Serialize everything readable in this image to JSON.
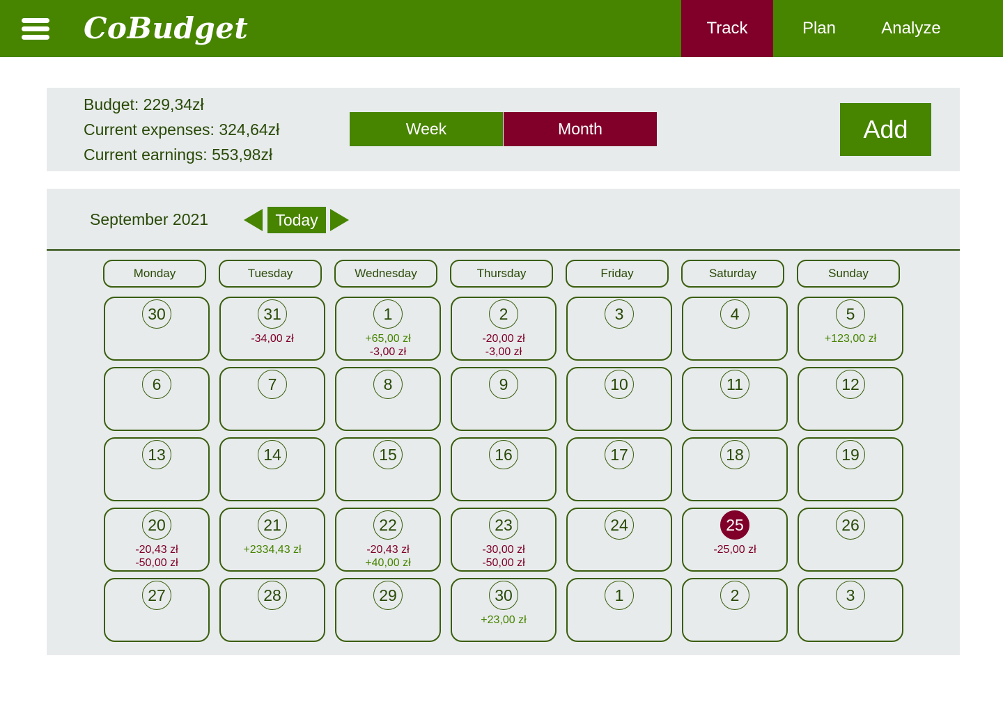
{
  "app": {
    "brand": "CoBudget",
    "nav": [
      {
        "label": "Track",
        "active": true
      },
      {
        "label": "Plan",
        "active": false
      },
      {
        "label": "Analyze",
        "active": false
      }
    ]
  },
  "summary": {
    "budget": "Budget: 229,34zł",
    "expenses": "Current expenses: 324,64zł",
    "earnings": "Current earnings: 553,98zł",
    "view_toggle": [
      {
        "label": "Week",
        "active": false
      },
      {
        "label": "Month",
        "active": true
      }
    ],
    "add_label": "Add"
  },
  "calendar": {
    "month_label": "September 2021",
    "today_label": "Today",
    "weekdays": [
      "Monday",
      "Tuesday",
      "Wednesday",
      "Thursday",
      "Friday",
      "Saturday",
      "Sunday"
    ],
    "weeks": [
      [
        {
          "day": "30",
          "tx": []
        },
        {
          "day": "31",
          "tx": [
            {
              "text": "-34,00 zł",
              "kind": "neg"
            }
          ]
        },
        {
          "day": "1",
          "tx": [
            {
              "text": "+65,00 zł",
              "kind": "pos"
            },
            {
              "text": "-3,00 zł",
              "kind": "neg"
            }
          ]
        },
        {
          "day": "2",
          "tx": [
            {
              "text": "-20,00 zł",
              "kind": "neg"
            },
            {
              "text": "-3,00 zł",
              "kind": "neg"
            }
          ]
        },
        {
          "day": "3",
          "tx": []
        },
        {
          "day": "4",
          "tx": []
        },
        {
          "day": "5",
          "tx": [
            {
              "text": "+123,00 zł",
              "kind": "pos"
            }
          ]
        }
      ],
      [
        {
          "day": "6",
          "tx": []
        },
        {
          "day": "7",
          "tx": []
        },
        {
          "day": "8",
          "tx": []
        },
        {
          "day": "9",
          "tx": []
        },
        {
          "day": "10",
          "tx": []
        },
        {
          "day": "11",
          "tx": []
        },
        {
          "day": "12",
          "tx": []
        }
      ],
      [
        {
          "day": "13",
          "tx": []
        },
        {
          "day": "14",
          "tx": []
        },
        {
          "day": "15",
          "tx": []
        },
        {
          "day": "16",
          "tx": []
        },
        {
          "day": "17",
          "tx": []
        },
        {
          "day": "18",
          "tx": []
        },
        {
          "day": "19",
          "tx": []
        }
      ],
      [
        {
          "day": "20",
          "tx": [
            {
              "text": "-20,43 zł",
              "kind": "neg"
            },
            {
              "text": "-50,00 zł",
              "kind": "neg"
            }
          ]
        },
        {
          "day": "21",
          "tx": [
            {
              "text": "+2334,43 zł",
              "kind": "pos"
            }
          ]
        },
        {
          "day": "22",
          "tx": [
            {
              "text": "-20,43 zł",
              "kind": "neg"
            },
            {
              "text": "+40,00 zł",
              "kind": "pos"
            }
          ]
        },
        {
          "day": "23",
          "tx": [
            {
              "text": "-30,00 zł",
              "kind": "neg"
            },
            {
              "text": "-50,00 zł",
              "kind": "neg"
            }
          ]
        },
        {
          "day": "24",
          "tx": []
        },
        {
          "day": "25",
          "tx": [
            {
              "text": "-25,00 zł",
              "kind": "neg"
            }
          ],
          "selected": true
        },
        {
          "day": "26",
          "tx": []
        }
      ],
      [
        {
          "day": "27",
          "tx": []
        },
        {
          "day": "28",
          "tx": []
        },
        {
          "day": "29",
          "tx": []
        },
        {
          "day": "30",
          "tx": [
            {
              "text": "+23,00 zł",
              "kind": "pos"
            }
          ]
        },
        {
          "day": "1",
          "tx": []
        },
        {
          "day": "2",
          "tx": []
        },
        {
          "day": "3",
          "tx": []
        }
      ]
    ]
  },
  "colors": {
    "primary_green": "#478400",
    "accent_maroon": "#80002a",
    "panel_gray": "#e7ebeb",
    "text_dark_green": "#2a4a08"
  }
}
